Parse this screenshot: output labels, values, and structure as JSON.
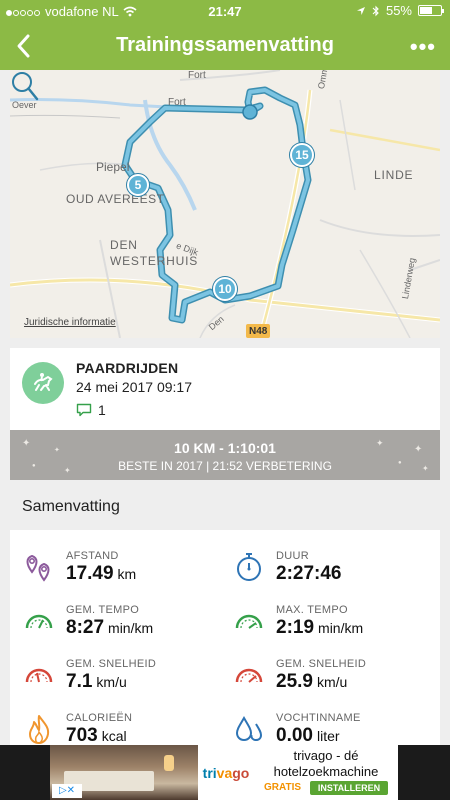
{
  "status_bar": {
    "carrier": "vodafone NL",
    "time": "21:47",
    "battery": "55%"
  },
  "nav": {
    "title": "Trainingssamenvatting",
    "more_label": "•••"
  },
  "map": {
    "labels": [
      "Fort",
      "Fort",
      "Oever",
      "Piepel",
      "Oud Avereest",
      "Den",
      "Westerhuis",
      "Linde",
      "Ommerweg",
      "e Dijk",
      "Den",
      "Linderweg",
      "N48"
    ],
    "markers": [
      "5",
      "10",
      "15"
    ],
    "legal_link": "Juridische informatie"
  },
  "activity": {
    "type": "PAARDRIJDEN",
    "datetime": "24 mei 2017 09:17",
    "comments": "1"
  },
  "achievement": {
    "headline": "10 KM - 1:10:01",
    "subline": "BESTE IN 2017  |  21:52 VERBETERING"
  },
  "summary": {
    "title": "Samenvatting",
    "stats": [
      {
        "label": "AFSTAND",
        "value": "17.49",
        "unit": "km",
        "icon": "location-pins-icon"
      },
      {
        "label": "DUUR",
        "value": "2:27:46",
        "unit": "",
        "icon": "stopwatch-icon"
      },
      {
        "label": "GEM. TEMPO",
        "value": "8:27",
        "unit": "min/km",
        "icon": "speedometer-icon"
      },
      {
        "label": "MAX. TEMPO",
        "value": "2:19",
        "unit": "min/km",
        "icon": "speedometer-icon"
      },
      {
        "label": "GEM. SNELHEID",
        "value": "7.1",
        "unit": "km/u",
        "icon": "speedometer-icon"
      },
      {
        "label": "GEM. SNELHEID",
        "value": "25.9",
        "unit": "km/u",
        "icon": "speedometer-icon"
      },
      {
        "label": "CALORIEËN",
        "value": "703",
        "unit": "kcal",
        "icon": "flame-icon"
      },
      {
        "label": "VOCHTINNAME",
        "value": "0.00",
        "unit": "liter",
        "icon": "water-drops-icon"
      }
    ]
  },
  "ad": {
    "brand": "trivago",
    "line1": "trivago - dé",
    "line2": "hotelzoekmachine",
    "free_label": "GRATIS",
    "install_label": "INSTALLEREN"
  },
  "colors": {
    "brand_green": "#8cba45",
    "route_blue": "#5fb3d6",
    "banner_gray": "#a8a6a3",
    "stat_icon_purple": "#8c5a9c",
    "stat_icon_green": "#35a04a",
    "stat_icon_red": "#d5473a",
    "stat_icon_orange": "#f0962f",
    "stat_icon_blue": "#2e74b5"
  }
}
